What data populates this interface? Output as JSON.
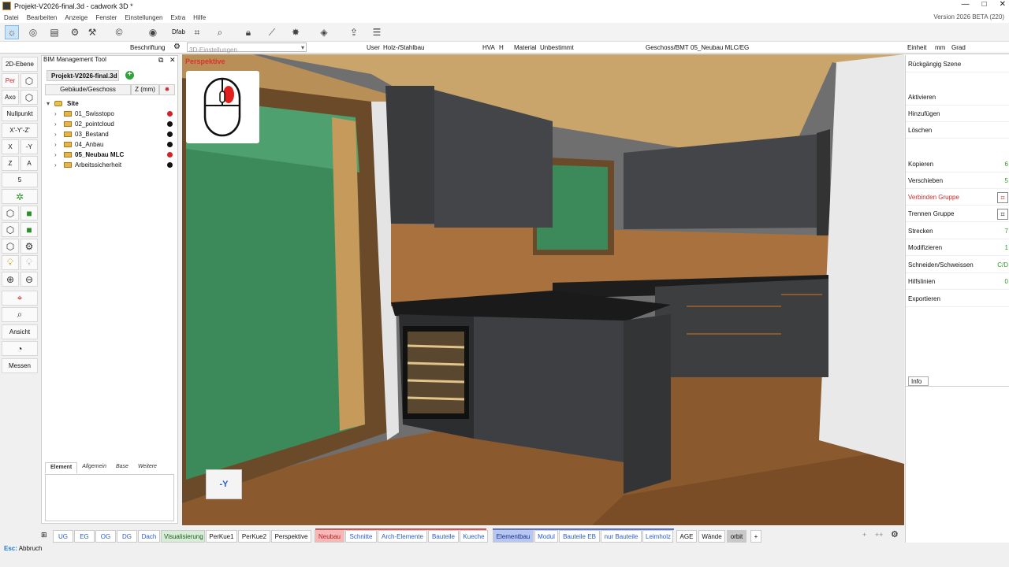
{
  "window": {
    "title": "Projekt-V2026-final.3d - cadwork 3D *",
    "version": "Version 2026 BETA (220)",
    "min": "—",
    "max": "□",
    "close": "✕"
  },
  "menu": [
    "Datei",
    "Bearbeiten",
    "Anzeige",
    "Fenster",
    "Einstellungen",
    "Extra",
    "Hilfe"
  ],
  "toolbar": {
    "dfab": "Dfab"
  },
  "options": {
    "beschriftung": "Beschriftung",
    "einstellungen_placeholder": "3D-Einstellungen",
    "user_label": "User",
    "user_value": "Holz-/Stahlbau",
    "hva": "HVA",
    "h": "H",
    "material_label": "Material",
    "material_value": "Unbestimmt",
    "geschoss_label": "Geschoss/BMT",
    "geschoss_value": "05_Neubau MLC/EG",
    "einheit_label": "Einheit",
    "einheit_value": "mm",
    "angle_unit": "Grad"
  },
  "left_tools": {
    "ebene": "2D-Ebene",
    "per": "Per",
    "axo": "Axo",
    "nullpunkt": "Nullpunkt",
    "xyz": "X'-Y'-Z'",
    "x": "X",
    "minus_y": "-Y",
    "z": "Z",
    "a": "A",
    "five": "5",
    "ansicht": "Ansicht",
    "messen": "Messen"
  },
  "bim": {
    "title": "BIM Management Tool",
    "project_tab": "Projekt-V2026-final.3d",
    "col_building": "Gebäude/Geschoss",
    "col_z": "Z (mm)",
    "root": "Site",
    "items": [
      {
        "label": "01_Swisstopo",
        "bold": false,
        "color": "#d0242a"
      },
      {
        "label": "02_pointcloud",
        "bold": false,
        "color": "#111111"
      },
      {
        "label": "03_Bestand",
        "bold": false,
        "color": "#111111"
      },
      {
        "label": "04_Anbau",
        "bold": false,
        "color": "#111111"
      },
      {
        "label": "05_Neubau MLC",
        "bold": true,
        "color": "#d0242a"
      },
      {
        "label": "Arbeitssicherheit",
        "bold": false,
        "color": "#111111"
      }
    ],
    "prop_tabs": [
      "Element",
      "Allgemein",
      "Base",
      "Weitere"
    ]
  },
  "viewport": {
    "label": "Perspektive",
    "axis": "-Y"
  },
  "right_panel": {
    "items": [
      {
        "label": "Rückgängig Szene",
        "shortcut": "",
        "red": false,
        "icon": false
      },
      {
        "label": "Aktivieren",
        "shortcut": "",
        "red": false,
        "icon": false
      },
      {
        "label": "Hinzufügen",
        "shortcut": "",
        "red": false,
        "icon": false
      },
      {
        "label": "Löschen",
        "shortcut": "",
        "red": false,
        "icon": false
      },
      {
        "label": "Kopieren",
        "shortcut": "6",
        "red": false,
        "icon": false
      },
      {
        "label": "Verschieben",
        "shortcut": "5",
        "red": false,
        "icon": false
      },
      {
        "label": "Verbinden Gruppe",
        "shortcut": "",
        "red": true,
        "icon": true
      },
      {
        "label": "Trennen Gruppe",
        "shortcut": "",
        "red": false,
        "icon": true
      },
      {
        "label": "Strecken",
        "shortcut": "7",
        "red": false,
        "icon": false
      },
      {
        "label": "Modifizieren",
        "shortcut": "1",
        "red": false,
        "icon": false
      },
      {
        "label": "Schneiden/Schweissen",
        "shortcut": "C/D",
        "red": false,
        "icon": false
      },
      {
        "label": "Hilfslinien",
        "shortcut": "0",
        "red": false,
        "icon": false
      },
      {
        "label": "Exportieren",
        "shortcut": "",
        "red": false,
        "icon": false
      }
    ],
    "info": "Info"
  },
  "bottom_tabs": [
    {
      "label": "UG",
      "cls": ""
    },
    {
      "label": "EG",
      "cls": ""
    },
    {
      "label": "OG",
      "cls": ""
    },
    {
      "label": "DG",
      "cls": ""
    },
    {
      "label": "Dach",
      "cls": ""
    },
    {
      "label": "Visualisierung",
      "cls": "visual"
    },
    {
      "label": "PerKue1",
      "cls": "black"
    },
    {
      "label": "PerKue2",
      "cls": "black"
    },
    {
      "label": "Perspektive",
      "cls": "black"
    },
    {
      "label": "Neubau",
      "cls": "neubau"
    },
    {
      "label": "Schnitte",
      "cls": ""
    },
    {
      "label": "Arch-Elemente",
      "cls": ""
    },
    {
      "label": "Bauteile",
      "cls": ""
    },
    {
      "label": "Kueche",
      "cls": ""
    },
    {
      "label": "Elementbau",
      "cls": "elementbau"
    },
    {
      "label": "Modul",
      "cls": ""
    },
    {
      "label": "Bauteile EB",
      "cls": ""
    },
    {
      "label": "nur Bauteile",
      "cls": ""
    },
    {
      "label": "Leimholz",
      "cls": ""
    },
    {
      "label": "AGE",
      "cls": "black"
    },
    {
      "label": "Wände",
      "cls": "black"
    },
    {
      "label": "orbit",
      "cls": "orbit"
    },
    {
      "label": "+",
      "cls": "black"
    }
  ],
  "status": {
    "key": "Esc:",
    "text": " Abbruch"
  }
}
